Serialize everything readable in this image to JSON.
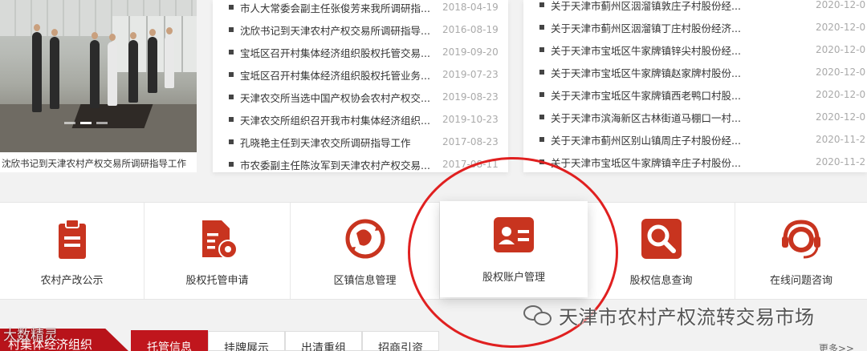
{
  "photo": {
    "caption": "沈欣书记到天津农村产权交易所调研指导工作"
  },
  "news_mid": [
    {
      "title": "市人大常委会副主任张俊芳来我所调研指...",
      "date": "2018-04-19"
    },
    {
      "title": "沈欣书记到天津农村产权交易所调研指导...",
      "date": "2016-08-19"
    },
    {
      "title": "宝坻区召开村集体经济组织股权托管交易...",
      "date": "2019-09-20"
    },
    {
      "title": "宝坻区召开村集体经济组织股权托管业务...",
      "date": "2019-07-23"
    },
    {
      "title": "天津农交所当选中国产权协会农村产权交...",
      "date": "2019-08-23"
    },
    {
      "title": "天津农交所组织召开我市村集体经济组织...",
      "date": "2019-10-23"
    },
    {
      "title": "孔晓艳主任到天津农交所调研指导工作",
      "date": "2017-08-23"
    },
    {
      "title": "市农委副主任陈汝军到天津农村产权交易...",
      "date": "2017-08-11"
    }
  ],
  "news_right": [
    {
      "title": "关于天津市蓟州区洇溜镇敦庄子村股份经...",
      "date": "2020-12-0"
    },
    {
      "title": "关于天津市蓟州区洇溜镇丁庄村股份经济...",
      "date": "2020-12-0"
    },
    {
      "title": "关于天津市宝坻区牛家牌镇锌尖村股份经...",
      "date": "2020-12-0"
    },
    {
      "title": "关于天津市宝坻区牛家牌镇赵家牌村股份...",
      "date": "2020-12-0"
    },
    {
      "title": "关于天津市宝坻区牛家牌镇西老鸭口村股...",
      "date": "2020-12-0"
    },
    {
      "title": "关于天津市滨海新区古林街道马棚口一村...",
      "date": "2020-12-0"
    },
    {
      "title": "关于天津市蓟州区别山镇周庄子村股份经...",
      "date": "2020-11-2"
    },
    {
      "title": "关于天津市宝坻区牛家牌镇辛庄子村股份...",
      "date": "2020-11-2"
    }
  ],
  "menu": [
    {
      "label": "农村产改公示",
      "icon": "clipboard-icon"
    },
    {
      "label": "股权托管申请",
      "icon": "document-gear-icon"
    },
    {
      "label": "区镇信息管理",
      "icon": "globe-refresh-icon"
    },
    {
      "label": "股权账户管理",
      "icon": "id-card-icon"
    },
    {
      "label": "股权信息查询",
      "icon": "search-icon"
    },
    {
      "label": "在线问题咨询",
      "icon": "headset-icon"
    }
  ],
  "watermark": {
    "text": "天津市农村产权流转交易市场"
  },
  "bottom": {
    "section_label": "村集体经济组织",
    "tabs": [
      "托管信息",
      "挂牌展示",
      "出清重组",
      "招商引资"
    ],
    "more": "更多>>",
    "brand": "大数精灵"
  },
  "colors": {
    "accent": "#c0161d",
    "highlight_circle": "#e02020"
  }
}
